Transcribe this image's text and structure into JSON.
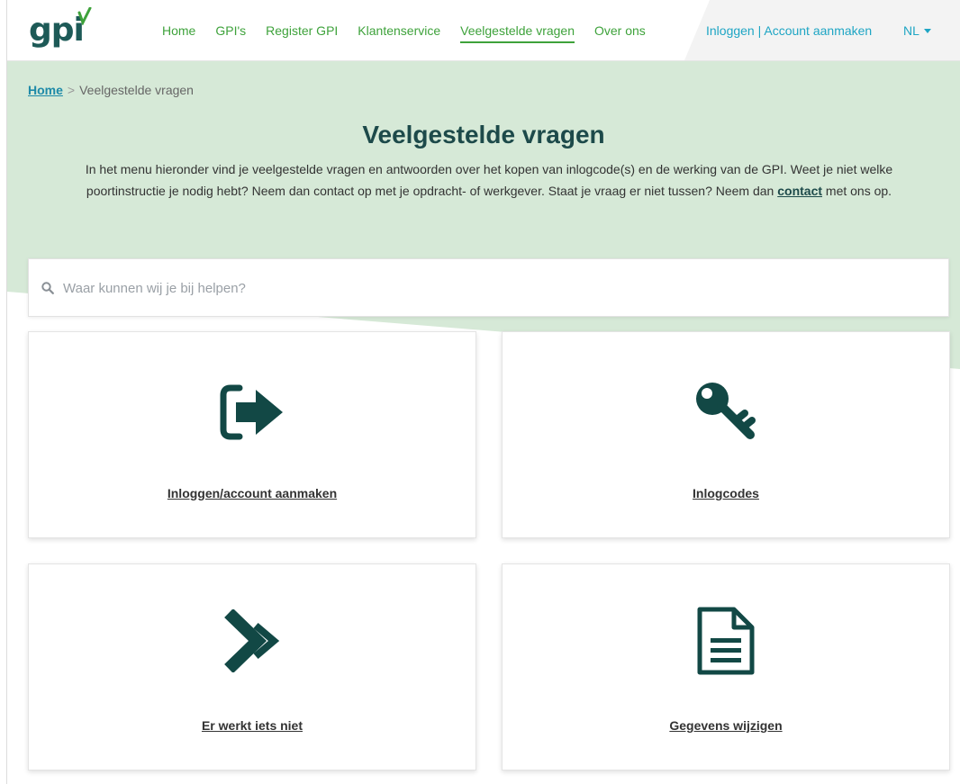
{
  "header": {
    "logo": "gpi",
    "nav": [
      {
        "label": "Home"
      },
      {
        "label": "GPI's"
      },
      {
        "label": "Register GPI"
      },
      {
        "label": "Klantenservice"
      },
      {
        "label": "Veelgestelde vragen",
        "active": true
      },
      {
        "label": "Over ons"
      }
    ],
    "account_link": "Inloggen | Account aanmaken",
    "language": "NL"
  },
  "breadcrumb": {
    "home": "Home",
    "separator": ">",
    "current": "Veelgestelde vragen"
  },
  "hero": {
    "title": "Veelgestelde vragen",
    "intro_line1": "In het menu hieronder vind je veelgestelde vragen en antwoorden over het kopen van inlogcode(s) en de werking van de GPI. Weet je niet welke",
    "intro_line2a": "poortinstructie je nodig hebt? Neem dan contact op met je opdracht- of werkgever. Staat je vraag er niet tussen? Neem dan ",
    "intro_link": "contact",
    "intro_line2b": " met ons op."
  },
  "search": {
    "placeholder": "Waar kunnen wij je bij helpen?",
    "value": ""
  },
  "cards": [
    {
      "label": "Inloggen/account aanmaken",
      "icon": "sign-in-icon"
    },
    {
      "label": "Inlogcodes",
      "icon": "key-icon"
    },
    {
      "label": "Er werkt iets niet",
      "icon": "double-chevron-right-icon"
    },
    {
      "label": "Gegevens wijzigen",
      "icon": "document-icon"
    }
  ],
  "colors": {
    "brand_dark": "#1d4a4a",
    "nav_green": "#3ea23b",
    "link_blue": "#1ea5c4",
    "hero_bg": "#d6e9d7"
  }
}
